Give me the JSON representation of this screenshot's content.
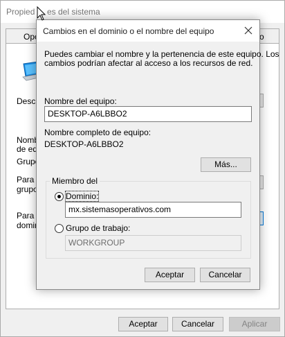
{
  "parent": {
    "title_left": "Propied",
    "title_right": "es del sistema",
    "tab_left": "Opc",
    "tab_right": "o",
    "label_description": "Descri",
    "label_name_1": "Nombr",
    "label_name_2": "de equ",
    "label_group": "Grupo",
    "label_para1_1": "Para u",
    "label_para1_2": "grupo d",
    "label_para2_1": "Para c",
    "label_para2_2": "domini",
    "buttons": {
      "accept": "Aceptar",
      "cancel": "Cancelar",
      "apply": "Aplicar"
    }
  },
  "dialog": {
    "title": "Cambios en el dominio o el nombre del equipo",
    "intro_line1": "Puedes cambiar el nombre y la pertenencia de este equipo. Los",
    "intro_line2": "cambios podrían afectar al acceso a los recursos de red.",
    "computer_name_label": "Nombre del equipo:",
    "computer_name_value": "DESKTOP-A6LBBO2",
    "full_name_label": "Nombre completo de equipo:",
    "full_name_value": "DESKTOP-A6LBBO2",
    "more_button": "Más...",
    "member_of": {
      "label": "Miembro del",
      "domain_label": "Dominio:",
      "domain_value": "mx.sistemasoperativos.com",
      "domain_selected": true,
      "workgroup_label": "Grupo de trabajo:",
      "workgroup_value": "WORKGROUP",
      "workgroup_selected": false
    },
    "accept_button": "Aceptar",
    "cancel_button": "Cancelar"
  },
  "colors": {
    "accent": "#0078d7",
    "window_bg": "#f0f0f0",
    "disabled_text": "#838383"
  },
  "icons": [
    "computer-icon",
    "close-icon",
    "mouse-cursor-icon"
  ]
}
